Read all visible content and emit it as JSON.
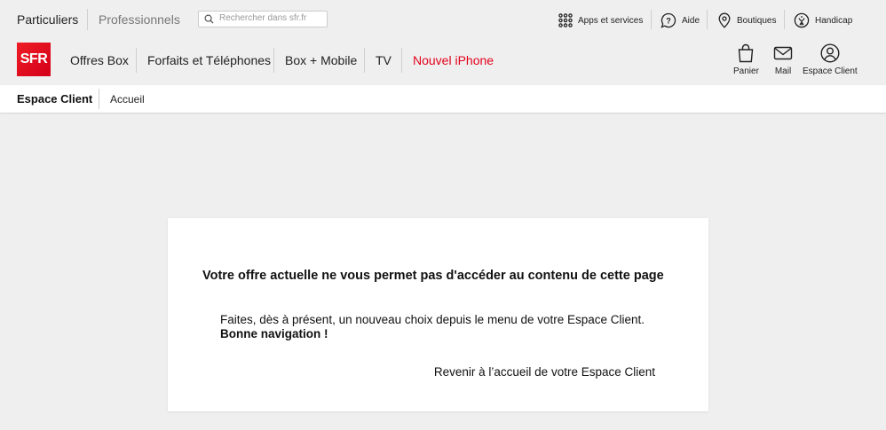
{
  "segments": {
    "particuliers": "Particuliers",
    "professionnels": "Professionnels"
  },
  "search": {
    "placeholder": "Rechercher dans sfr.fr"
  },
  "utility": {
    "apps": "Apps et services",
    "aide": "Aide",
    "boutiques": "Boutiques",
    "handicap": "Handicap"
  },
  "brand": {
    "logo_text": "SFR",
    "color": "#e2001a"
  },
  "nav": {
    "items": [
      "Offres Box",
      "Forfaits et Téléphones",
      "Box + Mobile",
      "TV"
    ],
    "highlight": "Nouvel iPhone"
  },
  "actions": {
    "panier": "Panier",
    "mail": "Mail",
    "espace_client": "Espace Client"
  },
  "subbar": {
    "title": "Espace Client",
    "accueil": "Accueil"
  },
  "card": {
    "title": "Votre offre actuelle ne vous permet pas d'accéder au contenu de cette page",
    "text": "Faites, dès à présent, un nouveau choix depuis le menu de votre Espace Client.",
    "strong": "Bonne navigation !",
    "link": "Revenir à l’accueil de votre Espace Client"
  }
}
